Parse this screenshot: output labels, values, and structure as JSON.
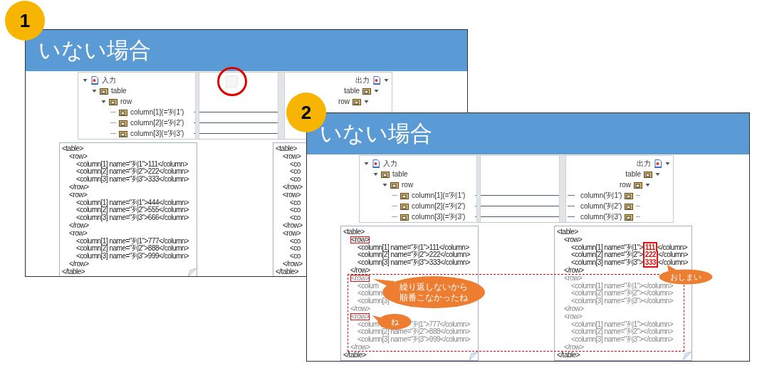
{
  "slides": [
    {
      "badge": "1",
      "title": "いない場合",
      "circled": true,
      "dashed_frame": false,
      "mapping": {
        "input": {
          "label": "入力",
          "expanded": true,
          "children": [
            {
              "label": "table",
              "expanded": true,
              "children": [
                {
                  "label": "row",
                  "expanded": true,
                  "children": [
                    {
                      "label": "column[1](='列1')"
                    },
                    {
                      "label": "column[2](='列2')"
                    },
                    {
                      "label": "column[3](='列3')"
                    }
                  ]
                }
              ]
            }
          ]
        },
        "output": {
          "label": "出力",
          "expanded": true,
          "children": [
            {
              "label": "table",
              "expanded": true,
              "children": [
                {
                  "label": "row",
                  "expanded": true
                }
              ]
            }
          ]
        }
      },
      "documents": [
        {
          "text": "<table>",
          "close": "</table>",
          "children": [
            {
              "text": "<row>",
              "close": "</row>",
              "faded": false,
              "boxed": false,
              "children": [
                {
                  "text": "<column[1] name=\"列1\">111</column>"
                },
                {
                  "text": "<column[2] name=\"列2\">222</column>"
                },
                {
                  "text": "<column[3] name=\"列3\">333</column>"
                }
              ]
            },
            {
              "text": "<row>",
              "close": "</row>",
              "faded": false,
              "boxed": false,
              "children": [
                {
                  "text": "<column[1] name=\"列1\">444</column>"
                },
                {
                  "text": "<column[2] name=\"列2\">555</column>"
                },
                {
                  "text": "<column[3] name=\"列3\">666</column>"
                }
              ]
            },
            {
              "text": "<row>",
              "close": "</row>",
              "faded": false,
              "boxed": false,
              "children": [
                {
                  "text": "<column[1] name=\"列1\">777</column>"
                },
                {
                  "text": "<column[2] name=\"列2\">888</column>"
                },
                {
                  "text": "<column[3] name=\"列3\">999</column>"
                }
              ]
            }
          ]
        },
        {
          "text": "<table>",
          "close": "</table>",
          "children": [
            {
              "text": "<row>",
              "close": "</row>",
              "faded": false,
              "boxed": false,
              "children": [
                {
                  "text": "<co"
                },
                {
                  "text": "<co"
                },
                {
                  "text": "<co"
                }
              ]
            },
            {
              "text": "<row>",
              "close": "</row>",
              "faded": false,
              "boxed": false,
              "children": [
                {
                  "text": "<co"
                },
                {
                  "text": "<co"
                },
                {
                  "text": "<co"
                }
              ]
            },
            {
              "text": "<row>",
              "close": "</row>",
              "faded": false,
              "boxed": false,
              "children": [
                {
                  "text": "<co"
                },
                {
                  "text": "<co"
                },
                {
                  "text": "<co"
                }
              ]
            }
          ]
        }
      ]
    },
    {
      "badge": "2",
      "title": "いない場合",
      "circled": false,
      "dashed_frame": true,
      "mapping": {
        "input": {
          "label": "入力",
          "expanded": true,
          "children": [
            {
              "label": "table",
              "expanded": true,
              "children": [
                {
                  "label": "row",
                  "expanded": true,
                  "children": [
                    {
                      "label": "column[1](='列1')"
                    },
                    {
                      "label": "column[2](='列2')"
                    },
                    {
                      "label": "column[3](='列3')"
                    }
                  ]
                }
              ]
            }
          ]
        },
        "output": {
          "label": "出力",
          "expanded": true,
          "children": [
            {
              "label": "table",
              "expanded": true,
              "children": [
                {
                  "label": "row",
                  "expanded": true,
                  "children": [
                    {
                      "label": "column('列1')"
                    },
                    {
                      "label": "column('列2')"
                    },
                    {
                      "label": "column('列3')"
                    }
                  ]
                }
              ]
            }
          ]
        }
      },
      "documents": [
        {
          "text": "<table>",
          "close": "</table>",
          "children": [
            {
              "text": "<row>",
              "close": "</row>",
              "faded": false,
              "boxed": true,
              "children": [
                {
                  "text": "<column[1] name=\"列1\">111</column>"
                },
                {
                  "text": "<column[2] name=\"列2\">222</column>"
                },
                {
                  "text": "<column[3] name=\"列3\">333</column>"
                }
              ]
            },
            {
              "text": "<row>",
              "close": "</row>",
              "faded": true,
              "boxed": true,
              "children": [
                {
                  "text": "<colum"
                },
                {
                  "text": "<column"
                },
                {
                  "text": "<column[3]"
                }
              ]
            },
            {
              "text": "<row>",
              "close": "</row>",
              "faded": true,
              "boxed": true,
              "children": [
                {
                  "text": "<colum",
                  "text_after": "\"列1\">777</column>"
                },
                {
                  "text": "<column[2] name=\"列2\">888</column>"
                },
                {
                  "text": "<column[3] name=\"列3\">999</column>"
                }
              ]
            }
          ]
        },
        {
          "text": "<table>",
          "close": "</table>",
          "children": [
            {
              "text": "<row>",
              "close": "</row>",
              "faded": false,
              "boxed": false,
              "children": [
                {
                  "text": "<column[1] name=\"列1\">",
                  "value": "111",
                  "suffix": "</column>",
                  "highlighted": true
                },
                {
                  "text": "<column[2] name=\"列2\">",
                  "value": "222",
                  "suffix": "</column>",
                  "highlighted": true
                },
                {
                  "text": "<column[3] name=\"列3\">",
                  "value": "333",
                  "suffix": "</column>",
                  "highlighted": true
                }
              ]
            },
            {
              "text": "<row>",
              "close": "</row>",
              "faded": true,
              "boxed": false,
              "children": [
                {
                  "text": "<column[1] name=\"列1\"></column>"
                },
                {
                  "text": "<column[2] name=\"列2\"></column>"
                },
                {
                  "text": "<column[3] name=\"列3\"></column>"
                }
              ]
            },
            {
              "text": "<row>",
              "close": "</row>",
              "faded": true,
              "boxed": false,
              "children": [
                {
                  "text": "<column[1] name=\"列1\"></column>"
                },
                {
                  "text": "<column[2] name=\"列2\"></column>"
                },
                {
                  "text": "<column[3] name=\"列3\"></column>"
                }
              ]
            }
          ]
        }
      ],
      "callouts": [
        {
          "text": "繰り返しないから順番こなかったね"
        },
        {
          "text": "ね"
        },
        {
          "text": "おしまい"
        }
      ]
    }
  ]
}
